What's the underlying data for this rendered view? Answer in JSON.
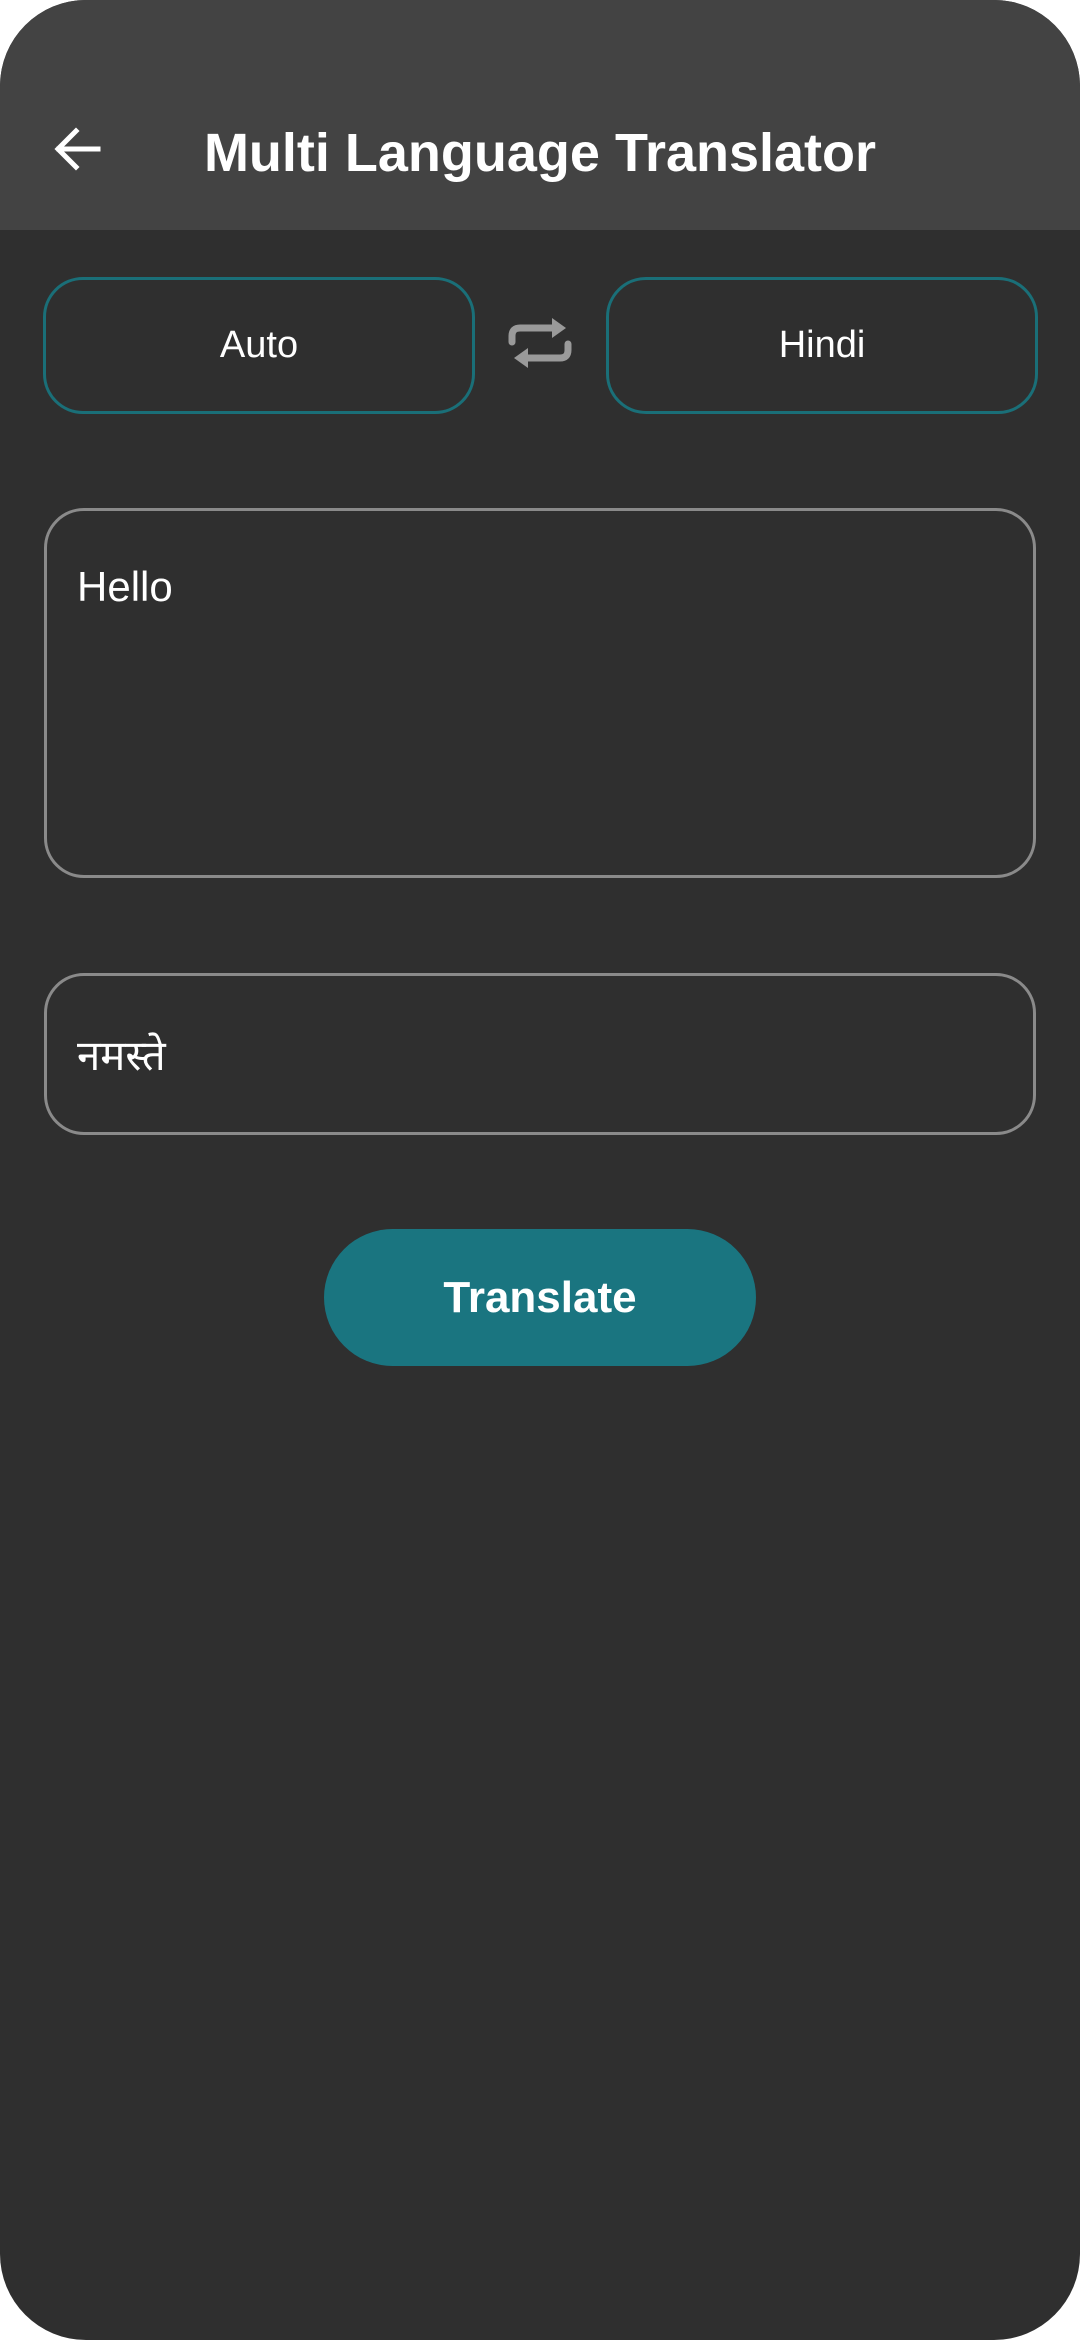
{
  "app_bar": {
    "title": "Multi Language Translator",
    "back_icon": "arrow-left-icon"
  },
  "languages": {
    "source": "Auto",
    "target": "Hindi",
    "swap_icon": "swap-arrows-icon"
  },
  "input": {
    "value": "Hello"
  },
  "output": {
    "value": "नमस्ते"
  },
  "actions": {
    "translate_label": "Translate"
  },
  "colors": {
    "background": "#2f2f2f",
    "app_bar": "#434343",
    "accent": "#1a7580",
    "accent_border": "#1a6f78",
    "field_border": "#8a8a8a",
    "icon_gray": "#9a9a9a"
  }
}
